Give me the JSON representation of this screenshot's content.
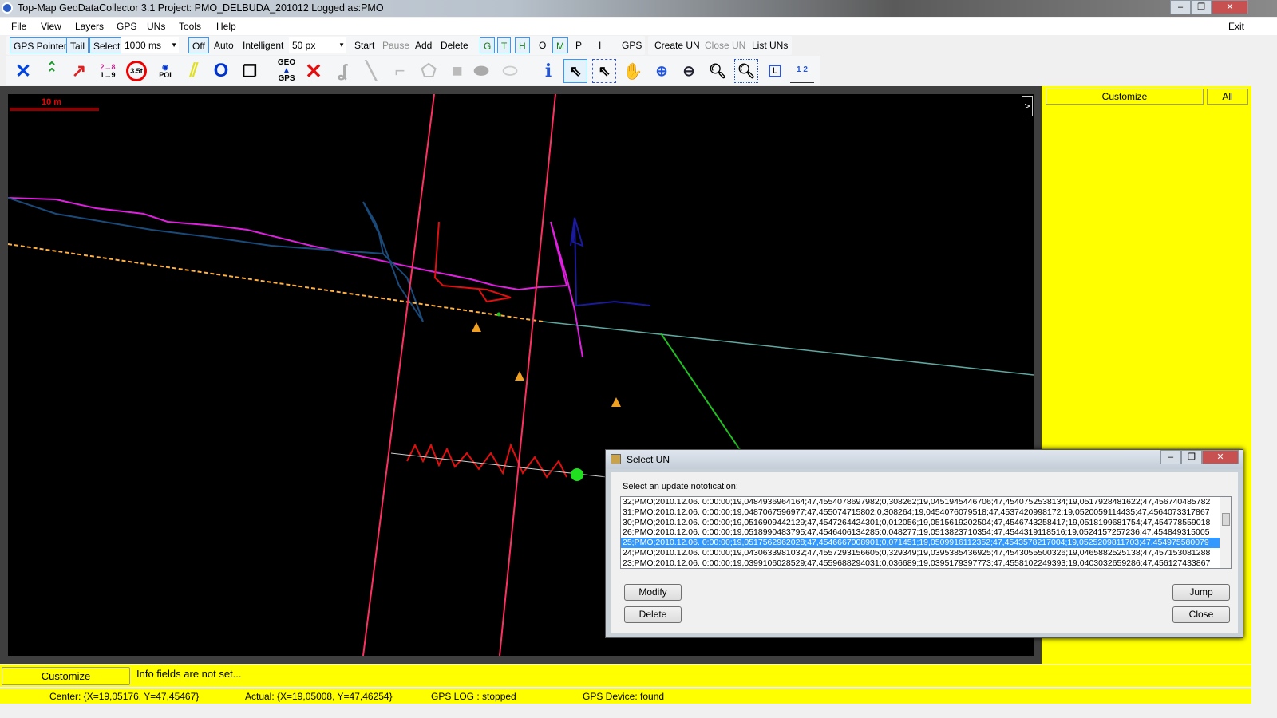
{
  "window": {
    "title": "Top-Map GeoDataCollector 3.1    Project: PMO_DELBUDA_201012  Logged as:PMO",
    "exit": "Exit"
  },
  "menu": [
    "File",
    "View",
    "Layers",
    "GPS",
    "UNs",
    "Tools",
    "Help"
  ],
  "toolbar": {
    "gps_pointer": "GPS Pointer",
    "tail": "Tail",
    "select": "Select",
    "interval": "1000 ms",
    "off": "Off",
    "auto": "Auto",
    "intelligent": "Intelligent",
    "px": "50 px",
    "start": "Start",
    "pause": "Pause",
    "add": "Add",
    "delete": "Delete",
    "layers": [
      "G",
      "T",
      "H",
      "O",
      "M",
      "P",
      "I"
    ],
    "gps": "GPS",
    "create_un": "Create UN",
    "close_un": "Close UN",
    "list_uns": "List UNs"
  },
  "icons": {
    "speed": "3.5t",
    "poi": "POI",
    "geo": "GEO",
    "gps": "GPS",
    "ratio_top": "2→8",
    "ratio_bottom": "1→9",
    "info": "i",
    "layer": "L",
    "ruler": "1 2"
  },
  "map": {
    "scale": "10 m"
  },
  "right_panel": {
    "customize": "Customize",
    "all": "All"
  },
  "info": {
    "customize": "Customize",
    "text": "Info fields are not set..."
  },
  "status": {
    "center": "Center: {X=19,05176, Y=47,45467}",
    "actual": "Actual: {X=19,05008, Y=47,46254}",
    "gps_log": "GPS LOG : stopped",
    "gps_device": "GPS Device: found"
  },
  "dialog": {
    "title": "Select UN",
    "prompt": "Select an update notofication:",
    "rows": [
      "32;PMO;2010.12.06. 0:00:00;19,0484936964164;47,4554078697982;0,308262;19,0451945446706;47,4540752538134;19,0517928481622;47,456740485782",
      "31;PMO;2010.12.06. 0:00:00;19,0487067596977;47,455074715802;0,308264;19,0454076079518;47,4537420998172;19,0520059114435;47,4564073317867",
      "30;PMO;2010.12.06. 0:00:00;19,0516909442129;47,4547264424301;0,012056;19,0515619202504;47,4546743258417;19,0518199681754;47,454778559018",
      "26;PMO;2010.12.06. 0:00:00;19,0518990483795;47,4546406134285;0,048277;19,0513823710354;47,4544319118516;19,0524157257236;47,454849315005",
      "25;PMO;2010.12.06. 0:00:00;19,0517562962028;47,4546667008901;0,071451;19,0509916112352;47,4543578217004;19,0525209811703;47,454975580079",
      "24;PMO;2010.12.06. 0:00:00;19,0430633981032;47,4557293156605;0,329349;19,0395385436925;47,4543055500326;19,0465882525138;47,457153081288",
      "23;PMO;2010.12.06. 0:00:00;19,0399106028529;47,4559688294031;0,036689;19,0395179397773;47,4558102249393;19,0403032659286;47,456127433867"
    ],
    "selected_index": 4,
    "modify": "Modify",
    "delete": "Delete",
    "jump": "Jump",
    "close": "Close"
  }
}
